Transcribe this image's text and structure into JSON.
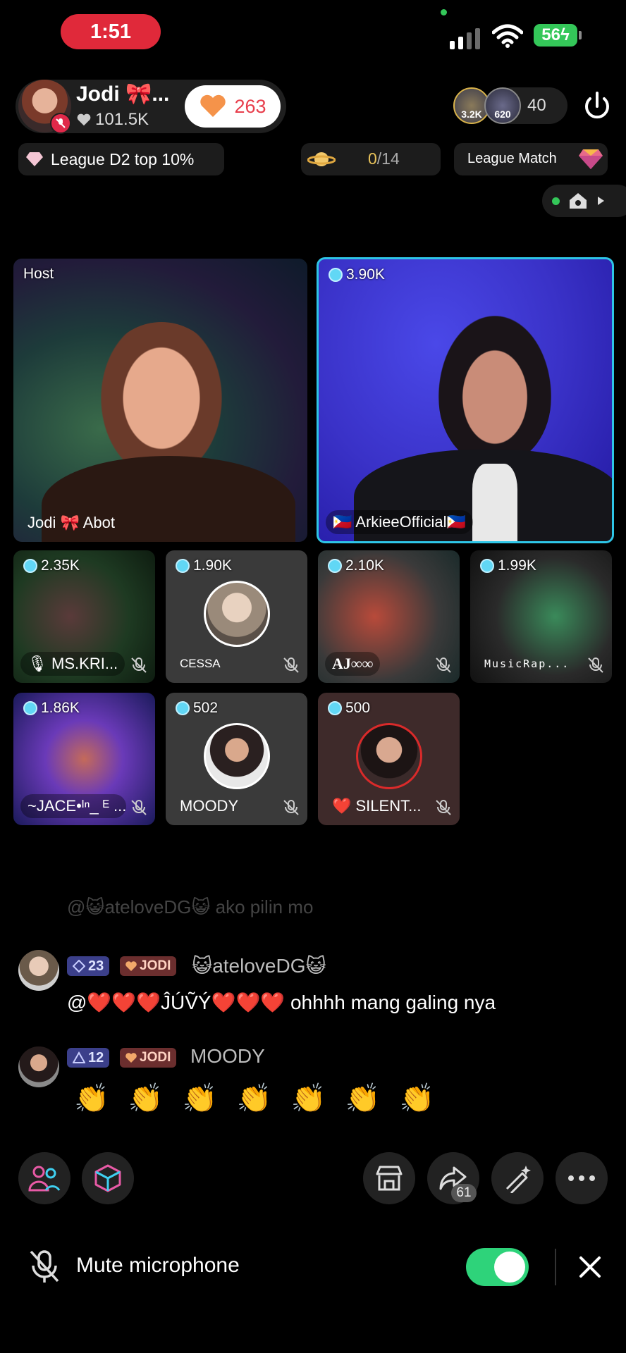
{
  "status_bar": {
    "time": "1:51",
    "battery": "56"
  },
  "host": {
    "name": "Jodi 🎀...",
    "likes": "101.5K",
    "gift_count": "263"
  },
  "viewers": {
    "avatar_1_count": "3.2K",
    "avatar_2_count": "620",
    "count": "40"
  },
  "league": {
    "label": "League D2 top 10%",
    "progress_current": "0",
    "progress_total": "/14",
    "match_label": "League Match"
  },
  "tiles": [
    {
      "label": "Host",
      "name": "Jodi 🎀 Abot"
    },
    {
      "coins": "3.90K",
      "name": "🇵🇭 ArkieeOfficial🇵🇭"
    },
    {
      "coins": "2.35K",
      "name": "🎙 MS.KRI..."
    },
    {
      "coins": "1.90K",
      "name": "CESSA"
    },
    {
      "coins": "2.10K",
      "name": "AJ∞∞"
    },
    {
      "coins": "1.99K",
      "name": "MusicRap..."
    },
    {
      "coins": "1.86K",
      "name": "~JACE•ᴵⁿ_ ᴱ ..."
    },
    {
      "coins": "502",
      "name": "MOODY"
    },
    {
      "coins": "500",
      "name": "❤️ SILENT..."
    }
  ],
  "chat": {
    "faded": "@😺ateloveDG😺 ako pilin mo",
    "messages": [
      {
        "level": "23",
        "fan_badge": "JODI",
        "user": "😺ateloveDG😺",
        "text": "@❤️❤️❤️ĴÚṼÝ❤️❤️❤️ ohhhh mang galing nya"
      },
      {
        "level": "12",
        "fan_badge": "JODI",
        "user": "MOODY",
        "text": "👏 👏 👏 👏 👏 👏 👏"
      }
    ]
  },
  "toolbar": {
    "share_count": "61"
  },
  "mute": {
    "label": "Mute microphone",
    "enabled": true
  },
  "colors": {
    "accent_cyan": "#2ec5e6",
    "toggle_green": "#2ed37a",
    "badge_red": "#e0293a"
  }
}
